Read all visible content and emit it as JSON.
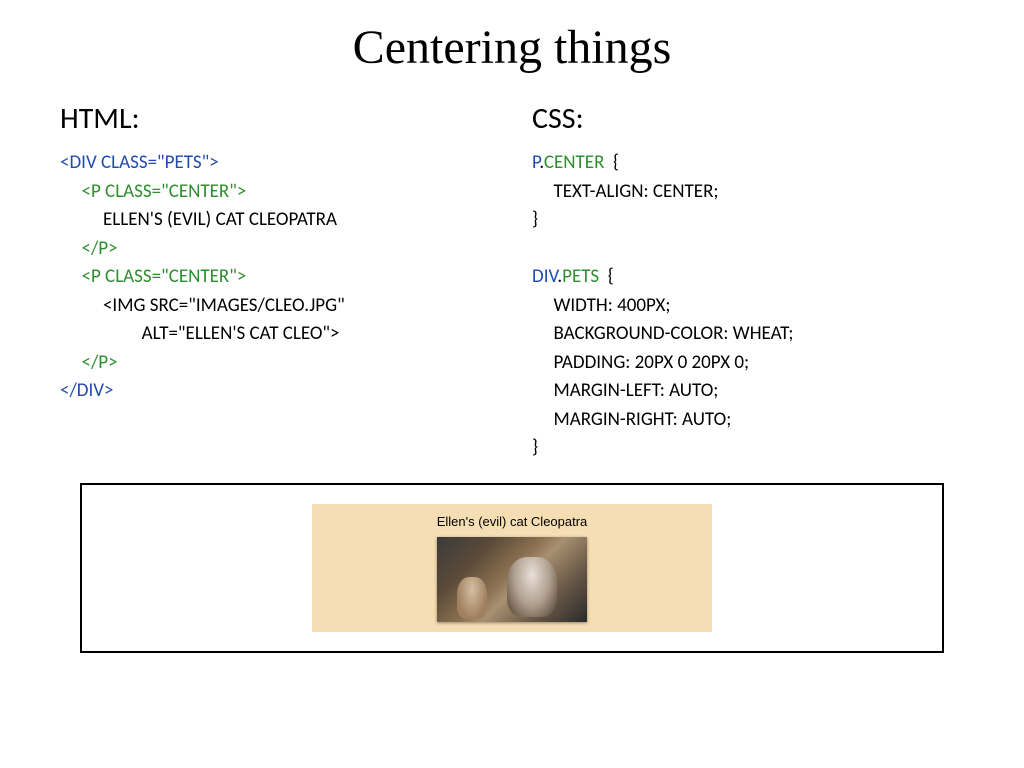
{
  "title": "Centering things",
  "left": {
    "heading": "HTML:",
    "code_html": "<span class='blue'>&lt;DIV CLASS=&quot;PETS&quot;&gt;</span>\n     <span class='green'>&lt;P CLASS=&quot;CENTER&quot;&gt;</span>\n          ELLEN'S (EVIL) CAT CLEOPATRA\n     <span class='green'>&lt;/P&gt;</span>\n     <span class='green'>&lt;P CLASS=&quot;CENTER&quot;&gt;</span>\n          &lt;IMG SRC=&quot;IMAGES/CLEO.JPG&quot;\n                   ALT=&quot;ELLEN'S CAT CLEO&quot;&gt;\n     <span class='green'>&lt;/P&gt;</span>\n<span class='blue'>&lt;/DIV&gt;</span>"
  },
  "right": {
    "heading": "CSS:",
    "code_html": "<span class='blue'>P</span>.<span class='green'>CENTER</span>  {\n     TEXT-ALIGN: CENTER;\n}\n\n<span class='blue'>DIV</span>.<span class='green'>PETS</span>  {\n     WIDTH: 400PX;\n     BACKGROUND-COLOR: WHEAT;\n     PADDING: 20PX 0 20PX 0;\n     MARGIN-LEFT: AUTO;\n     MARGIN-RIGHT: AUTO;\n}"
  },
  "output": {
    "caption": "Ellen's (evil) cat Cleopatra"
  }
}
